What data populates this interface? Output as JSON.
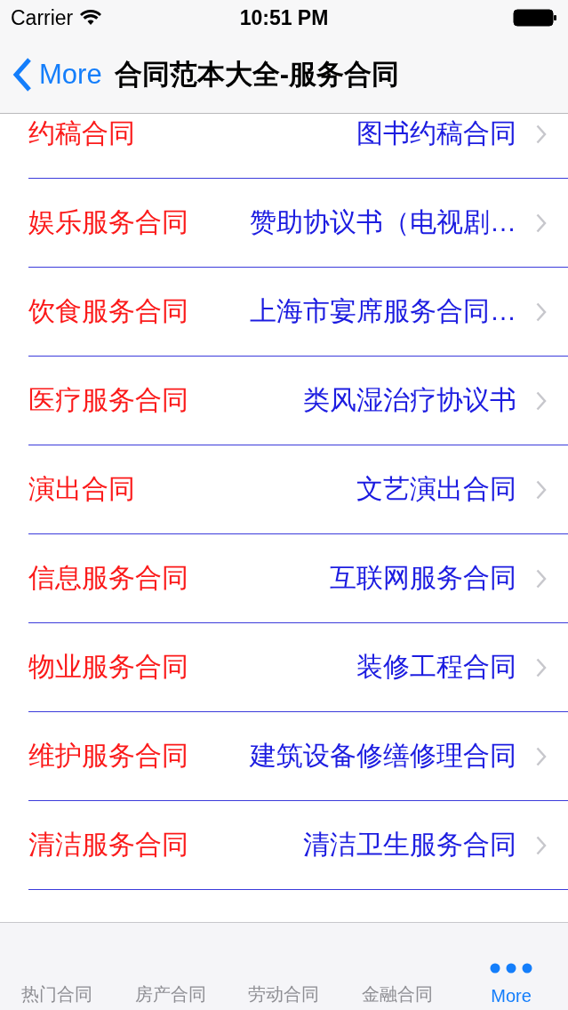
{
  "status_bar": {
    "carrier": "Carrier",
    "time": "10:51 PM"
  },
  "nav": {
    "back": "More",
    "title": "合同范本大全-服务合同"
  },
  "rows": [
    {
      "label": "约稿合同",
      "detail": "图书约稿合同"
    },
    {
      "label": "娱乐服务合同",
      "detail": "赞助协议书（电视剧…"
    },
    {
      "label": "饮食服务合同",
      "detail": "上海市宴席服务合同…"
    },
    {
      "label": "医疗服务合同",
      "detail": "类风湿治疗协议书"
    },
    {
      "label": "演出合同",
      "detail": "文艺演出合同"
    },
    {
      "label": "信息服务合同",
      "detail": "互联网服务合同"
    },
    {
      "label": "物业服务合同",
      "detail": "装修工程合同"
    },
    {
      "label": "维护服务合同",
      "detail": "建筑设备修缮修理合同"
    },
    {
      "label": "清洁服务合同",
      "detail": "清洁卫生服务合同"
    }
  ],
  "tabs": [
    {
      "label": "热门合同",
      "kind": "text",
      "selected": false
    },
    {
      "label": "房产合同",
      "kind": "text",
      "selected": false
    },
    {
      "label": "劳动合同",
      "kind": "text",
      "selected": false
    },
    {
      "label": "金融合同",
      "kind": "text",
      "selected": false
    },
    {
      "label": "More",
      "kind": "more",
      "selected": true
    }
  ]
}
